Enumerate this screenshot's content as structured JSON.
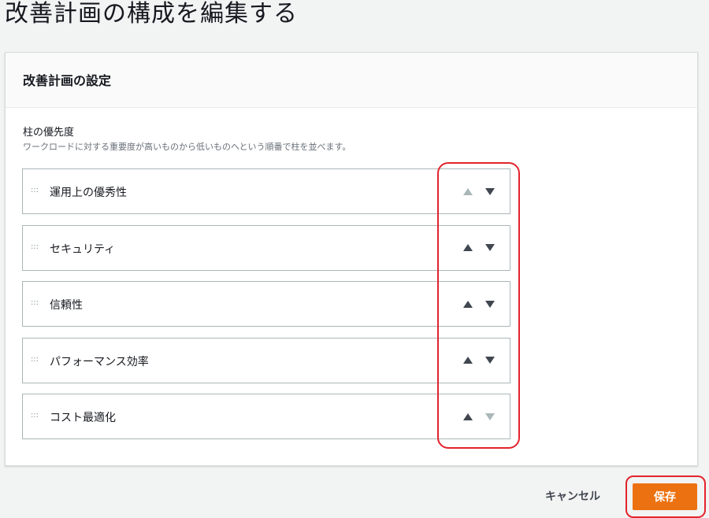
{
  "page": {
    "title": "改善計画の構成を編集する"
  },
  "panel": {
    "header_title": "改善計画の設定",
    "field_label": "柱の優先度",
    "field_description": "ワークロードに対する重要度が高いものから低いものへという順番で柱を並べます。"
  },
  "pillars": [
    {
      "label": "運用上の優秀性",
      "drag_handle": ":::",
      "up_enabled": false,
      "down_enabled": true
    },
    {
      "label": "セキュリティ",
      "drag_handle": ":::",
      "up_enabled": true,
      "down_enabled": true
    },
    {
      "label": "信頼性",
      "drag_handle": ":::",
      "up_enabled": true,
      "down_enabled": true
    },
    {
      "label": "パフォーマンス効率",
      "drag_handle": ":::",
      "up_enabled": true,
      "down_enabled": true
    },
    {
      "label": "コスト最適化",
      "drag_handle": ":::",
      "up_enabled": true,
      "down_enabled": false
    }
  ],
  "footer": {
    "cancel_label": "キャンセル",
    "save_label": "保存"
  },
  "colors": {
    "accent": "#ec7211",
    "highlight": "#e3232c",
    "arrow_enabled": "#414750",
    "arrow_disabled": "#aab7b8"
  },
  "icons": {
    "up": "caret-up-icon",
    "down": "caret-down-icon",
    "drag": "drag-handle-icon"
  }
}
